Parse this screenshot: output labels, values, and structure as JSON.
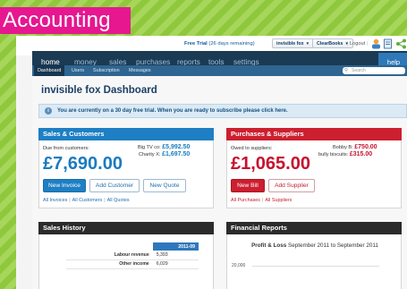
{
  "banner": {
    "title": "Accounting"
  },
  "topbar": {
    "trial_bold": "Free Trial",
    "trial_rest": " (26 days remaining)",
    "org_select": "invisible fox",
    "product_select": "ClearBooks",
    "logout": "Logout"
  },
  "nav": {
    "items": [
      {
        "label": "home",
        "active": true
      },
      {
        "label": "money"
      },
      {
        "label": "sales"
      },
      {
        "label": "purchases"
      },
      {
        "label": "reports"
      },
      {
        "label": "tools"
      },
      {
        "label": "settings"
      }
    ],
    "help": "help"
  },
  "subnav": {
    "items": [
      {
        "label": "Dashboard",
        "active": true
      },
      {
        "label": "Users"
      },
      {
        "label": "Subscription"
      },
      {
        "label": "Messages"
      }
    ],
    "search_placeholder": "Search"
  },
  "dashboard": {
    "title": "invisible fox Dashboard",
    "notice": "You are currently on a 30 day free trial. When you are ready to subscribe please click here."
  },
  "sales": {
    "header": "Sales & Customers",
    "due_label": "Due from customers:",
    "due_total": "£7,690.00",
    "debtors": [
      {
        "name": "Big TV co:",
        "amount": "£5,992.50"
      },
      {
        "name": "Charity X:",
        "amount": "£1,697.50"
      }
    ],
    "buttons": {
      "new_invoice": "New Invoice",
      "add_customer": "Add Customer",
      "new_quote": "New Quote"
    },
    "links": {
      "invoices": "All Invoices",
      "customers": "All Customers",
      "quotes": "All Quotes"
    }
  },
  "purchases": {
    "header": "Purchases & Suppliers",
    "owed_label": "Owed to suppliers:",
    "owed_total": "£1,065.00",
    "creditors": [
      {
        "name": "Bobby B:",
        "amount": "£750.00"
      },
      {
        "name": "bully biscuits:",
        "amount": "£315.00"
      }
    ],
    "buttons": {
      "new_bill": "New Bill",
      "add_supplier": "Add Supplier"
    },
    "links": {
      "purchases": "All Purchases",
      "suppliers": "All Suppliers"
    }
  },
  "sales_history": {
    "header": "Sales History",
    "column": "2011-09",
    "rows": [
      {
        "label": "Labour revenue",
        "value": "5,393"
      },
      {
        "label": "Other income",
        "value": "6,029"
      }
    ]
  },
  "financial_reports": {
    "header": "Financial Reports",
    "chart_title_bold": "Profit & Loss",
    "chart_title_rest": " September 2011 to September 2011",
    "y_tick": "20,000"
  },
  "colors": {
    "banner": "#e6178f",
    "nav": "#1b3a53",
    "sales_accent": "#1e7fc4",
    "purchases_accent": "#cc1f2f",
    "dark_header": "#2b2b2b",
    "background_green": "#8fc83c"
  }
}
